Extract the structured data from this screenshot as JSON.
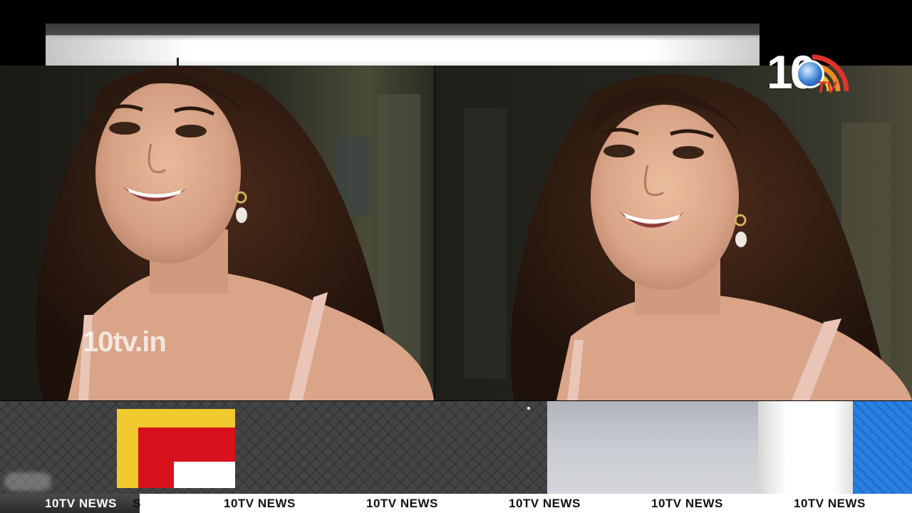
{
  "channel": {
    "logo_text": "10",
    "logo_sub": "TV",
    "watermark": "10tv.in",
    "ticker_label": "10TV NEWS",
    "ticker_fragment": "S",
    "ticker_items": [
      "10TV NEWS",
      "10TV NEWS",
      "10TV NEWS",
      "10TV NEWS",
      "10TV NEWS"
    ]
  },
  "colors": {
    "logo_red": "#e0322c",
    "logo_yellow": "#f0c92e",
    "brand_red": "#d8121c",
    "panel_blue": "#1e6fd0"
  },
  "icons": {
    "channel_logo": "10tv-logo-icon",
    "brand_square": "brand-square-icon"
  }
}
